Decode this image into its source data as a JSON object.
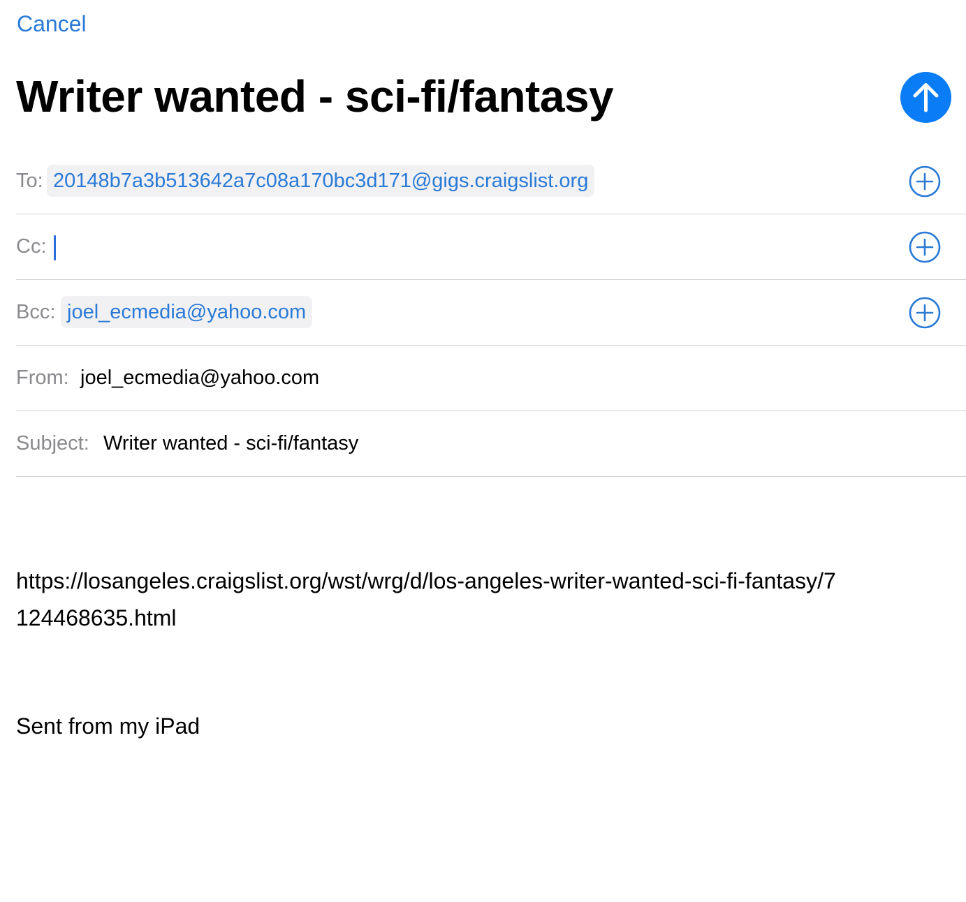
{
  "toolbar": {
    "cancel_label": "Cancel"
  },
  "compose": {
    "title": "Writer wanted - sci-fi/fantasy",
    "send_icon": "arrow-up-icon",
    "accent_color": "#0a7cf5"
  },
  "fields": {
    "to": {
      "label": "To:",
      "recipient": "20148b7a3b513642a7c08a170bc3d171@gigs.craigslist.org"
    },
    "cc": {
      "label": "Cc:",
      "value": ""
    },
    "bcc": {
      "label": "Bcc:",
      "recipient": "joel_ecmedia@yahoo.com"
    },
    "from": {
      "label": "From:",
      "value": "joel_ecmedia@yahoo.com"
    },
    "subject": {
      "label": "Subject:",
      "value": "Writer wanted - sci-fi/fantasy"
    },
    "add_icon": "plus-circle-icon"
  },
  "message": {
    "link": "https://losangeles.craigslist.org/wst/wrg/d/los-angeles-writer-wanted-sci-fi-fantasy/7124468635.html",
    "signature": "Sent from my iPad"
  }
}
